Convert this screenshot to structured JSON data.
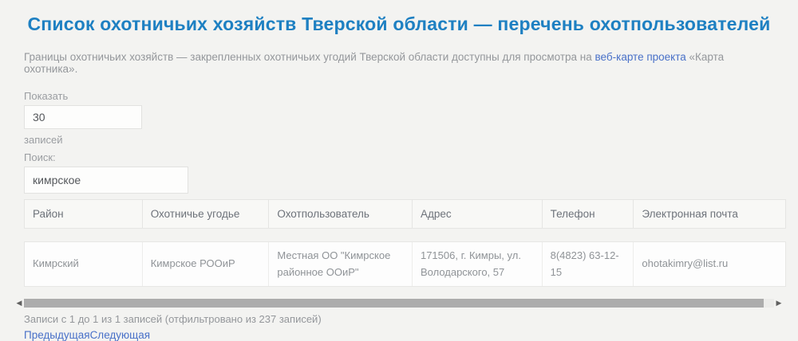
{
  "page": {
    "title": "Список охотничьих хозяйств Тверской области — перечень охотпользователей",
    "intro": {
      "text_before_link": "Границы охотничьих хозяйств — закрепленных охотничьих угодий Тверской области доступны для просмотра на ",
      "link_text": "веб-карте проекта",
      "text_after_link": " «Карта охотника»."
    }
  },
  "controls": {
    "length_label_before": "Показать",
    "length_value": "30",
    "length_label_after": "записей",
    "search_label": "Поиск:",
    "search_value": "кимрское"
  },
  "table": {
    "columns": [
      "Район",
      "Охотничье угодье",
      "Охотпользователь",
      "Адрес",
      "Телефон",
      "Электронная почта"
    ],
    "rows": [
      [
        "Кимрский",
        "Кимрское РООиР",
        "Местная ОО \"Кимрское районное ООиР\"",
        "171506, г. Кимры, ул. Володарского, 57",
        "8(4823) 63-12-15",
        "ohotakimry@list.ru"
      ]
    ]
  },
  "scrollbar": {
    "left_arrow": "◀",
    "right_arrow": "▶"
  },
  "footer": {
    "info": "Записи с 1 до 1 из 1 записей (отфильтровано из 237 записей)",
    "prev_label": "Предыдущая",
    "next_label": "Следующая"
  },
  "colors": {
    "title_accent": "#1e80c2",
    "link_blue": "#4870c8",
    "page_background": "#f3f3f1",
    "header_background": "#f8f8f6",
    "scrollbar_thumb": "#acacac"
  }
}
